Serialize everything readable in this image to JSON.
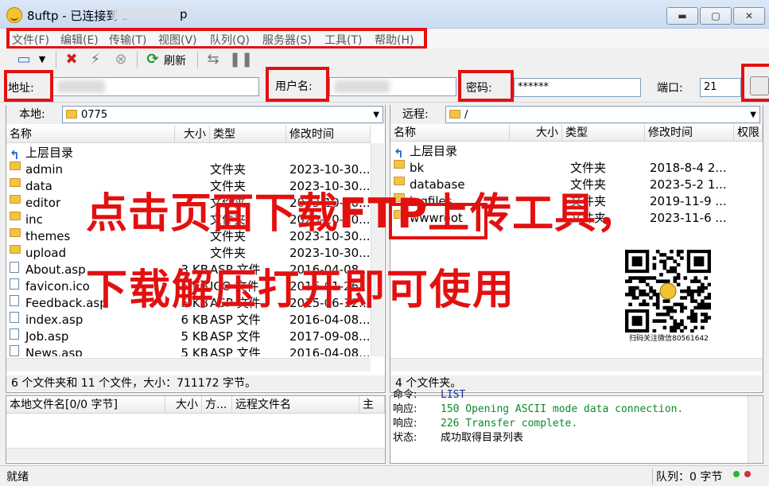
{
  "window": {
    "title_prefix": "8uftp - 已连接到 s",
    "title_suffix": "p",
    "min": "▬",
    "max": "▢",
    "close": "✕"
  },
  "menu": [
    "文件(F)",
    "编辑(E)",
    "传输(T)",
    "视图(V)",
    "队列(Q)",
    "服务器(S)",
    "工具(T)",
    "帮助(H)"
  ],
  "toolbar": {
    "refresh_label": "刷新"
  },
  "connect": {
    "address_label": "地址:",
    "user_label": "用户名:",
    "password_label": "密码:",
    "password_value": "******",
    "port_label": "端口:",
    "port_value": "21"
  },
  "local": {
    "path_label": "本地:",
    "path_value": "0775",
    "columns": [
      "名称",
      "大小",
      "类型",
      "修改时间"
    ],
    "parent": "上层目录",
    "rows": [
      {
        "name": "admin",
        "size": "",
        "type": "文件夹",
        "date": "2023-10-30...",
        "kind": "folder"
      },
      {
        "name": "data",
        "size": "",
        "type": "文件夹",
        "date": "2023-10-30...",
        "kind": "folder"
      },
      {
        "name": "editor",
        "size": "",
        "type": "文件夹",
        "date": "2023-10-30...",
        "kind": "folder"
      },
      {
        "name": "inc",
        "size": "",
        "type": "文件夹",
        "date": "2023-10-30...",
        "kind": "folder"
      },
      {
        "name": "themes",
        "size": "",
        "type": "文件夹",
        "date": "2023-10-30...",
        "kind": "folder"
      },
      {
        "name": "upload",
        "size": "",
        "type": "文件夹",
        "date": "2023-10-30...",
        "kind": "folder"
      },
      {
        "name": "About.asp",
        "size": "3 KB",
        "type": "ASP 文件",
        "date": "2016-04-08...",
        "kind": "file"
      },
      {
        "name": "favicon.ico",
        "size": "6 KB",
        "type": "ICO 文件",
        "date": "2016-01-26...",
        "kind": "file"
      },
      {
        "name": "Feedback.asp",
        "size": "5 KB",
        "type": "ASP 文件",
        "date": "2015-06-12...",
        "kind": "file"
      },
      {
        "name": "index.asp",
        "size": "6 KB",
        "type": "ASP 文件",
        "date": "2016-04-08...",
        "kind": "file"
      },
      {
        "name": "Job.asp",
        "size": "5 KB",
        "type": "ASP 文件",
        "date": "2017-09-08...",
        "kind": "file"
      },
      {
        "name": "News.asp",
        "size": "5 KB",
        "type": "ASP 文件",
        "date": "2016-04-08...",
        "kind": "file"
      }
    ],
    "status": "6 个文件夹和 11 个文件，大小：711172 字节。"
  },
  "remote": {
    "path_label": "远程:",
    "path_value": "/",
    "columns": [
      "名称",
      "大小",
      "类型",
      "修改时间",
      "权限"
    ],
    "parent": "上层目录",
    "rows": [
      {
        "name": "bk",
        "type": "文件夹",
        "date": "2018-8-4 2..."
      },
      {
        "name": "database",
        "type": "文件夹",
        "date": "2023-5-2 1..."
      },
      {
        "name": "logfiles",
        "type": "文件夹",
        "date": "2019-11-9 ..."
      },
      {
        "name": "wwwroot",
        "type": "文件夹",
        "date": "2023-11-6 ..."
      }
    ],
    "status": "4 个文件夹。",
    "qr_caption": "扫码关注微信80561642"
  },
  "queue": {
    "columns": [
      "本地文件名[0/0 字节]",
      "大小",
      "方...",
      "远程文件名",
      "主机"
    ]
  },
  "log": [
    {
      "label": "命令:",
      "text": "LIST",
      "color": "#1a2ea0"
    },
    {
      "label": "响应:",
      "text": "150 Opening ASCII mode data connection.",
      "color": "#0a8a2a"
    },
    {
      "label": "响应:",
      "text": "226 Transfer complete.",
      "color": "#0a8a2a"
    },
    {
      "label": "状态:",
      "text": "成功取得目录列表",
      "color": "#000000"
    }
  ],
  "statusbar": {
    "ready": "就绪",
    "queue": "队列：0 字节"
  },
  "overlay": {
    "line1": "点击页面下载FTP上传工具，",
    "line2": "下载解压打开即可使用"
  }
}
